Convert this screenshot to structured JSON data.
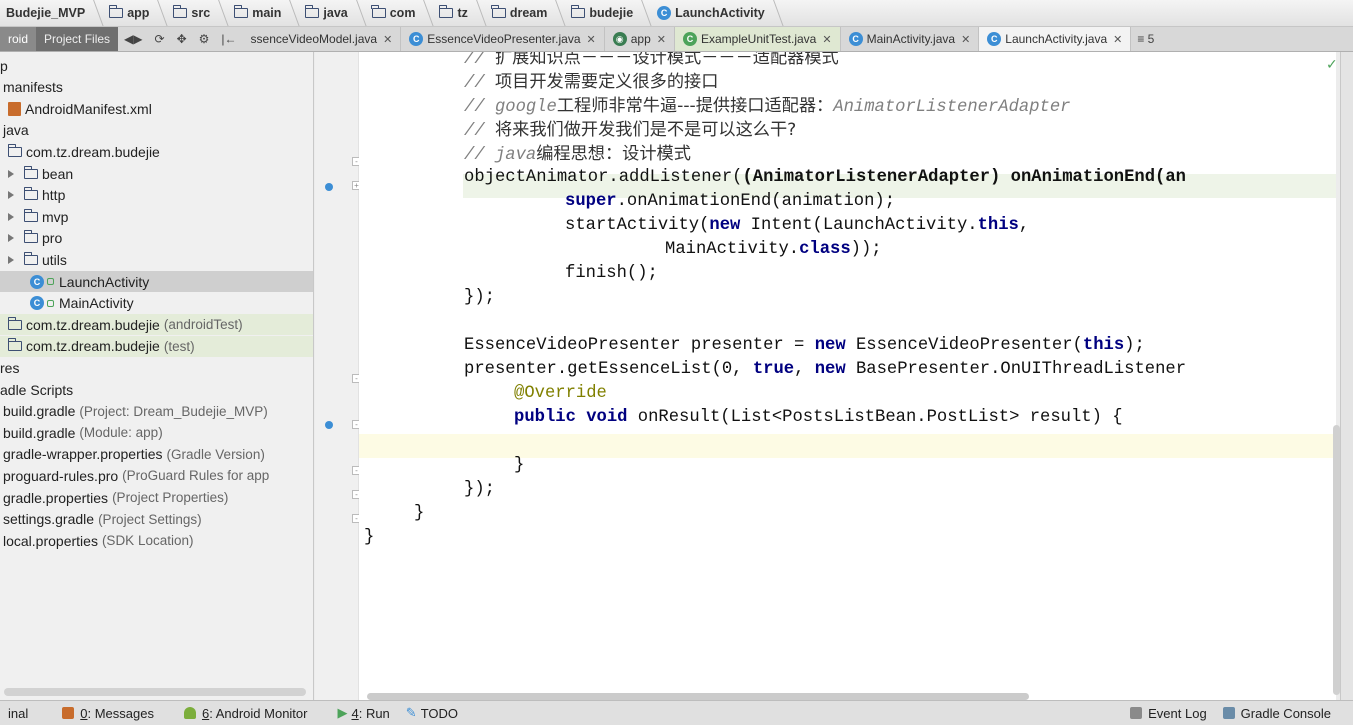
{
  "breadcrumbs": [
    {
      "label": "Budejie_MVP",
      "icon": "none"
    },
    {
      "label": "app",
      "icon": "folder-icon"
    },
    {
      "label": "src",
      "icon": "folder-icon"
    },
    {
      "label": "main",
      "icon": "folder-icon"
    },
    {
      "label": "java",
      "icon": "folder-icon"
    },
    {
      "label": "com",
      "icon": "folder-icon"
    },
    {
      "label": "tz",
      "icon": "folder-icon"
    },
    {
      "label": "dream",
      "icon": "folder-icon"
    },
    {
      "label": "budejie",
      "icon": "folder-icon"
    },
    {
      "label": "LaunchActivity",
      "icon": "class-icon"
    }
  ],
  "toolwindow": {
    "android_label": "roid",
    "project_files_label": "Project Files"
  },
  "tabs": [
    {
      "label": "ssenceVideoModel.java",
      "state": "normal"
    },
    {
      "label": "EssenceVideoPresenter.java",
      "state": "normal"
    },
    {
      "label": "app",
      "state": "normal"
    },
    {
      "label": "ExampleUnitTest.java",
      "state": "test"
    },
    {
      "label": "MainActivity.java",
      "state": "normal"
    },
    {
      "label": "LaunchActivity.java",
      "state": "active"
    }
  ],
  "tab_overflow": "≡ 5",
  "tree": [
    {
      "label": "p",
      "secondary": "",
      "indent": 0,
      "icon": "none",
      "arrow": false,
      "state": ""
    },
    {
      "label": "manifests",
      "secondary": "",
      "indent": 3,
      "icon": "none",
      "arrow": false,
      "state": ""
    },
    {
      "label": "AndroidManifest.xml",
      "secondary": "",
      "indent": 8,
      "icon": "xml-icon",
      "arrow": false,
      "state": ""
    },
    {
      "label": "java",
      "secondary": "",
      "indent": 3,
      "icon": "none",
      "arrow": false,
      "state": ""
    },
    {
      "label": "com.tz.dream.budejie",
      "secondary": "",
      "indent": 8,
      "icon": "folder-icon",
      "arrow": false,
      "state": ""
    },
    {
      "label": "bean",
      "secondary": "",
      "indent": 8,
      "icon": "folder-icon",
      "arrow": true,
      "state": ""
    },
    {
      "label": "http",
      "secondary": "",
      "indent": 8,
      "icon": "folder-icon",
      "arrow": true,
      "state": ""
    },
    {
      "label": "mvp",
      "secondary": "",
      "indent": 8,
      "icon": "folder-icon",
      "arrow": true,
      "state": ""
    },
    {
      "label": "pro",
      "secondary": "",
      "indent": 8,
      "icon": "folder-icon",
      "arrow": true,
      "state": ""
    },
    {
      "label": "utils",
      "secondary": "",
      "indent": 8,
      "icon": "folder-icon",
      "arrow": true,
      "state": ""
    },
    {
      "label": "LaunchActivity",
      "secondary": "",
      "indent": 30,
      "icon": "class-icon",
      "arrow": false,
      "state": "sel"
    },
    {
      "label": "MainActivity",
      "secondary": "",
      "indent": 30,
      "icon": "class-icon",
      "arrow": false,
      "state": ""
    },
    {
      "label": "com.tz.dream.budejie",
      "secondary": "(androidTest)",
      "indent": 8,
      "icon": "folder-icon",
      "arrow": false,
      "state": "test"
    },
    {
      "label": "com.tz.dream.budejie",
      "secondary": "(test)",
      "indent": 8,
      "icon": "folder-icon",
      "arrow": false,
      "state": "test"
    },
    {
      "label": "res",
      "secondary": "",
      "indent": 0,
      "icon": "none",
      "arrow": false,
      "state": ""
    },
    {
      "label": "adle Scripts",
      "secondary": "",
      "indent": 0,
      "icon": "none",
      "arrow": false,
      "state": ""
    },
    {
      "label": "build.gradle",
      "secondary": "(Project: Dream_Budejie_MVP)",
      "indent": 3,
      "icon": "none",
      "arrow": false,
      "state": ""
    },
    {
      "label": "build.gradle",
      "secondary": "(Module: app)",
      "indent": 3,
      "icon": "none",
      "arrow": false,
      "state": ""
    },
    {
      "label": "gradle-wrapper.properties",
      "secondary": "(Gradle Version)",
      "indent": 3,
      "icon": "none",
      "arrow": false,
      "state": ""
    },
    {
      "label": "proguard-rules.pro",
      "secondary": "(ProGuard Rules for app",
      "indent": 3,
      "icon": "none",
      "arrow": false,
      "state": ""
    },
    {
      "label": "gradle.properties",
      "secondary": "(Project Properties)",
      "indent": 3,
      "icon": "none",
      "arrow": false,
      "state": ""
    },
    {
      "label": "settings.gradle",
      "secondary": "(Project Settings)",
      "indent": 3,
      "icon": "none",
      "arrow": false,
      "state": ""
    },
    {
      "label": "local.properties",
      "secondary": "(SDK Location)",
      "indent": 3,
      "icon": "none",
      "arrow": false,
      "state": ""
    }
  ],
  "code_lines": [
    [
      {
        "t": "// ",
        "c": "cmt"
      },
      {
        "t": "扩展知识点－－－设计模式－－－适配器模式",
        "c": "cmt-cn"
      }
    ],
    [
      {
        "t": "// ",
        "c": "cmt"
      },
      {
        "t": "项目开发需要定义很多的接口",
        "c": "cmt-cn"
      }
    ],
    [
      {
        "t": "// google",
        "c": "cmt"
      },
      {
        "t": "工程师非常牛逼---提供接口适配器：",
        "c": "cmt-cn"
      },
      {
        "t": "AnimatorListenerAdapter",
        "c": "cmt"
      }
    ],
    [
      {
        "t": "// ",
        "c": "cmt"
      },
      {
        "t": "将来我们做开发我们是不是可以这么干?",
        "c": "cmt-cn"
      }
    ],
    [
      {
        "t": "// java",
        "c": "cmt"
      },
      {
        "t": "编程思想：设计模式",
        "c": "cmt-cn"
      }
    ],
    [
      {
        "t": "objectAnimator.addListener(",
        "c": ""
      },
      {
        "t": "(AnimatorListenerAdapter) onAnimationEnd(an",
        "c": "cast"
      }
    ],
    [
      {
        "t": "super",
        "c": "kw"
      },
      {
        "t": ".onAnimationEnd(animation);",
        "c": ""
      }
    ],
    [
      {
        "t": "startActivity(",
        "c": ""
      },
      {
        "t": "new ",
        "c": "kw"
      },
      {
        "t": "Intent(LaunchActivity.",
        "c": ""
      },
      {
        "t": "this",
        "c": "kw"
      },
      {
        "t": ",",
        "c": ""
      }
    ],
    [
      {
        "t": "MainActivity.",
        "c": ""
      },
      {
        "t": "class",
        "c": "kw"
      },
      {
        "t": "));",
        "c": ""
      }
    ],
    [
      {
        "t": "finish();",
        "c": ""
      }
    ],
    [
      {
        "t": "});",
        "c": ""
      }
    ],
    [
      {
        "t": "",
        "c": ""
      }
    ],
    [
      {
        "t": "EssenceVideoPresenter presenter = ",
        "c": ""
      },
      {
        "t": "new ",
        "c": "kw"
      },
      {
        "t": "EssenceVideoPresenter(",
        "c": ""
      },
      {
        "t": "this",
        "c": "kw"
      },
      {
        "t": ");",
        "c": ""
      }
    ],
    [
      {
        "t": "presenter.getEssenceList(0, ",
        "c": ""
      },
      {
        "t": "true",
        "c": "kw"
      },
      {
        "t": ", ",
        "c": ""
      },
      {
        "t": "new ",
        "c": "kw"
      },
      {
        "t": "BasePresenter.OnUIThreadListener",
        "c": ""
      }
    ],
    [
      {
        "t": "@Override",
        "c": "ann"
      }
    ],
    [
      {
        "t": "public void ",
        "c": "kw"
      },
      {
        "t": "onResult(List<PostsListBean.PostList> result) {",
        "c": ""
      }
    ],
    [
      {
        "t": "",
        "c": ""
      }
    ],
    [
      {
        "t": "}",
        "c": ""
      }
    ],
    [
      {
        "t": "});",
        "c": ""
      }
    ],
    [
      {
        "t": "}",
        "c": ""
      }
    ],
    [
      {
        "t": "}",
        "c": ""
      }
    ]
  ],
  "statusbar": {
    "terminal": "inal",
    "messages_num": "0",
    "messages": ": Messages",
    "monitor_num": "6",
    "monitor": ": Android Monitor",
    "run_num": "4",
    "run": ": Run",
    "todo": "TODO",
    "event_log": "Event Log",
    "gradle_console": "Gradle Console"
  },
  "colors": {
    "accent": "#3c8ed5",
    "keyword": "#000080",
    "comment": "#808080",
    "annotation": "#808000",
    "current_line": "#fdfbe4"
  }
}
